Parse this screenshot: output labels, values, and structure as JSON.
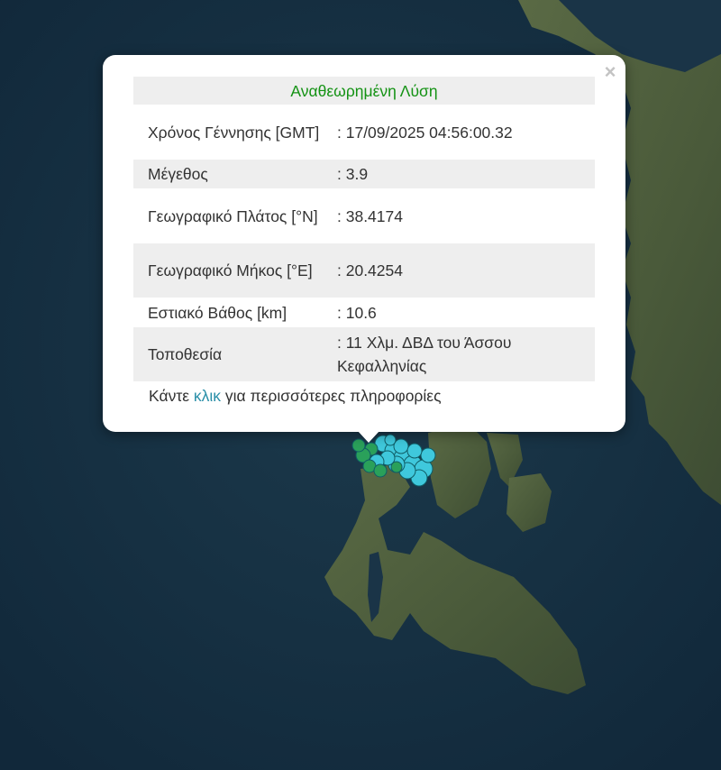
{
  "popup": {
    "title": "Αναθεωρημένη Λύση",
    "rows": [
      {
        "label": "Χρόνος Γέννησης [GMT]",
        "value": ": 17/09/2025 04:56:00.32"
      },
      {
        "label": "Μέγεθος",
        "value": ": 3.9"
      },
      {
        "label": "Γεωγραφικό Πλάτος [°N]",
        "value": ": 38.4174"
      },
      {
        "label": "Γεωγραφικό Μήκος [°E]",
        "value": ": 20.4254"
      },
      {
        "label": "Εστιακό Βάθος [km]",
        "value": ": 10.6"
      },
      {
        "label": "Τοποθεσία",
        "value": ": 11 Χλμ. ΔΒΔ του Άσσου Κεφαλληνίας"
      }
    ],
    "more_prefix": "Κάντε ",
    "more_link": "κλικ",
    "more_suffix": " για περισσότερες πληροφορίες",
    "close_symbol": "×"
  },
  "map": {
    "sea_color": "#173041",
    "land_color": "#4a5a3a",
    "marker_colors": {
      "recent": "#3fc8dc",
      "older": "#2aa05a"
    }
  }
}
